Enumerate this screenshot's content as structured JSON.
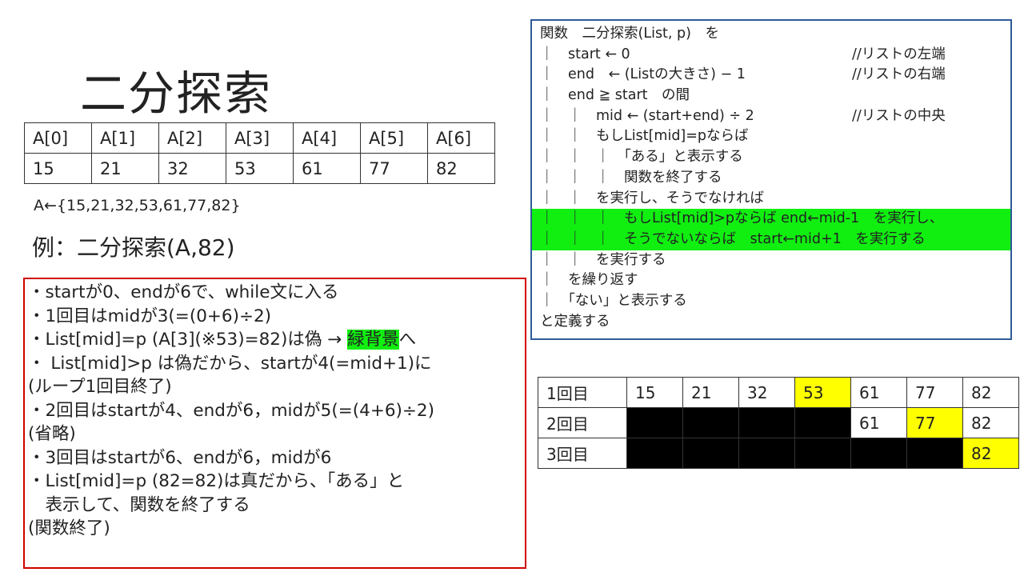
{
  "title": "二分探索",
  "array_table": {
    "headers": [
      "A[0]",
      "A[1]",
      "A[2]",
      "A[3]",
      "A[4]",
      "A[5]",
      "A[6]"
    ],
    "values": [
      "15",
      "21",
      "32",
      "53",
      "61",
      "77",
      "82"
    ]
  },
  "assignment": "A←{15,21,32,53,61,77,82}",
  "example": "例：二分探索(A,82)",
  "explanation": {
    "lines": [
      "・startが0、endが6で、while文に入る",
      "・1回目はmidが3(=(0+6)÷2)",
      "・List[mid]=p (A[3](※53)=82)は偽 → ",
      "・ List[mid]>p は偽だから、startが4(=mid+1)に",
      "(ループ1回目終了)",
      "・2回目はstartが4、endが6，midが5(=(4+6)÷2)",
      "(省略)",
      "・3回目はstartが6、endが6，midが6",
      "・List[mid]=p (82=82)は真だから、「ある」と",
      "　表示して、関数を終了する",
      "(関数終了)"
    ],
    "highlight_word": "緑背景",
    "highlight_suffix": "へ"
  },
  "pseudocode": {
    "lines": [
      {
        "text": "関数　二分探索(List, p)　を",
        "comment": ""
      },
      {
        "text": "｜　start ← 0",
        "comment": "//リストの左端"
      },
      {
        "text": "｜　end　← (Listの大きさ) − 1",
        "comment": "//リストの右端"
      },
      {
        "text": "｜　end ≧ start　の間",
        "comment": ""
      },
      {
        "text": "｜　｜　mid ← (start+end) ÷ 2",
        "comment": "//リストの中央"
      },
      {
        "text": "｜　｜　もしList[mid]=pならば",
        "comment": ""
      },
      {
        "text": "｜　｜　｜　「ある」と表示する",
        "comment": ""
      },
      {
        "text": "｜　｜　｜　関数を終了する",
        "comment": ""
      },
      {
        "text": "｜　｜　を実行し、そうでなければ",
        "comment": ""
      },
      {
        "text": "｜　｜　｜　もしList[mid]>pならば end←mid-1　を実行し、",
        "comment": ""
      },
      {
        "text": "｜　｜　｜　そうでないならば　start←mid+1　を実行する",
        "comment": ""
      },
      {
        "text": "｜　｜　を実行する",
        "comment": ""
      },
      {
        "text": "｜　を繰り返す",
        "comment": ""
      },
      {
        "text": "｜　「ない」と表示する",
        "comment": ""
      },
      {
        "text": "と定義する",
        "comment": ""
      }
    ],
    "highlight_color": "#11ef11"
  },
  "trace_table": {
    "rows": [
      {
        "label": "1回目",
        "cells": [
          "15",
          "21",
          "32",
          "53",
          "61",
          "77",
          "82"
        ],
        "state": [
          "",
          "",
          "",
          "y",
          "",
          "",
          ""
        ]
      },
      {
        "label": "2回目",
        "cells": [
          "",
          "",
          "",
          "",
          "61",
          "77",
          "82"
        ],
        "state": [
          "b",
          "b",
          "b",
          "b",
          "",
          "y",
          ""
        ]
      },
      {
        "label": "3回目",
        "cells": [
          "",
          "",
          "",
          "",
          "",
          "",
          "82"
        ],
        "state": [
          "b",
          "b",
          "b",
          "b",
          "b",
          "b",
          "y"
        ]
      }
    ],
    "colors": {
      "mid": "#ffff00",
      "excluded": "#000000"
    }
  }
}
